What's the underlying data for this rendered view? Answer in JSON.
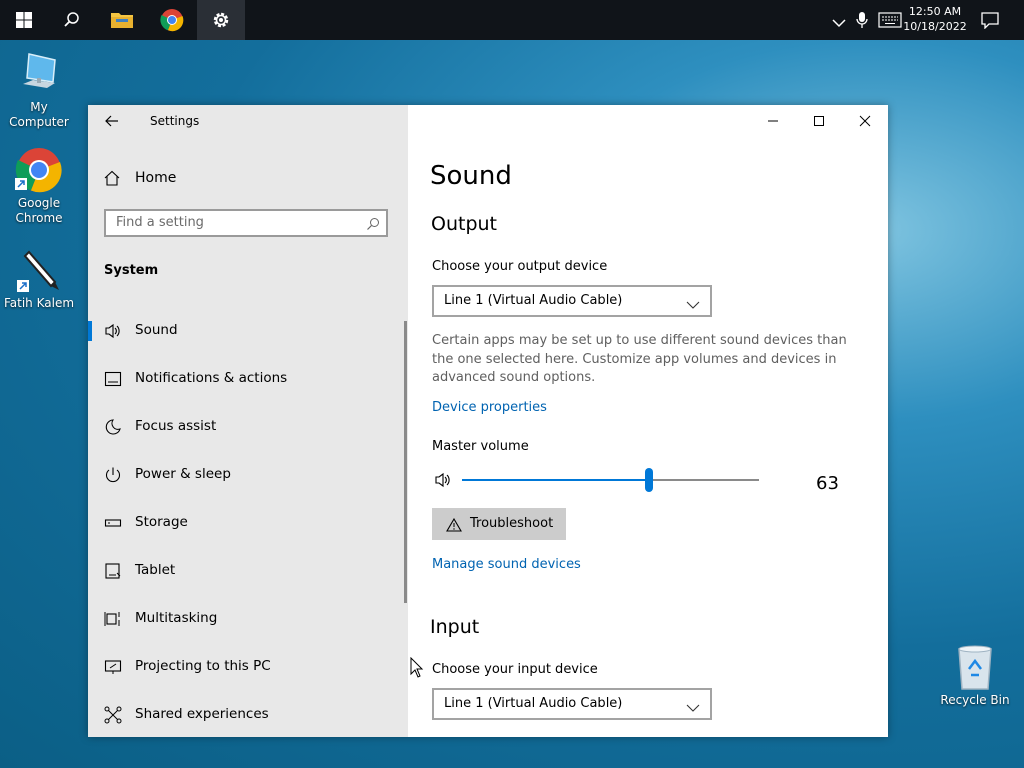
{
  "taskbar": {
    "time": "12:50 AM",
    "date": "10/18/2022"
  },
  "desktop": {
    "icons": [
      {
        "label": "My Computer"
      },
      {
        "label": "Google Chrome"
      },
      {
        "label": "Fatih Kalem"
      },
      {
        "label": "Recycle Bin"
      }
    ]
  },
  "window": {
    "title": "Settings",
    "sidebar": {
      "home_label": "Home",
      "search_placeholder": "Find a setting",
      "section_label": "System",
      "items": [
        {
          "label": "Sound",
          "icon": "speaker-icon",
          "selected": true
        },
        {
          "label": "Notifications & actions",
          "icon": "notification-icon"
        },
        {
          "label": "Focus assist",
          "icon": "moon-icon"
        },
        {
          "label": "Power & sleep",
          "icon": "power-icon"
        },
        {
          "label": "Storage",
          "icon": "storage-icon"
        },
        {
          "label": "Tablet",
          "icon": "tablet-icon"
        },
        {
          "label": "Multitasking",
          "icon": "multitasking-icon"
        },
        {
          "label": "Projecting to this PC",
          "icon": "projector-icon"
        },
        {
          "label": "Shared experiences",
          "icon": "share-icon"
        }
      ]
    },
    "content": {
      "page_title": "Sound",
      "output": {
        "heading": "Output",
        "device_label": "Choose your output device",
        "device_value": "Line 1 (Virtual Audio Cable)",
        "description": "Certain apps may be set up to use different sound devices than the one selected here. Customize app volumes and devices in advanced sound options.",
        "device_properties_link": "Device properties",
        "master_volume_label": "Master volume",
        "volume_value": "63",
        "volume_level": 63,
        "troubleshoot_label": "Troubleshoot",
        "manage_link": "Manage sound devices"
      },
      "input": {
        "heading": "Input",
        "device_label": "Choose your input device",
        "device_value": "Line 1 (Virtual Audio Cable)"
      }
    }
  },
  "colors": {
    "accent": "#0078d7",
    "link": "#0063b1",
    "sidebar_bg": "#e8e8e8",
    "taskbar_bg": "#101419"
  }
}
